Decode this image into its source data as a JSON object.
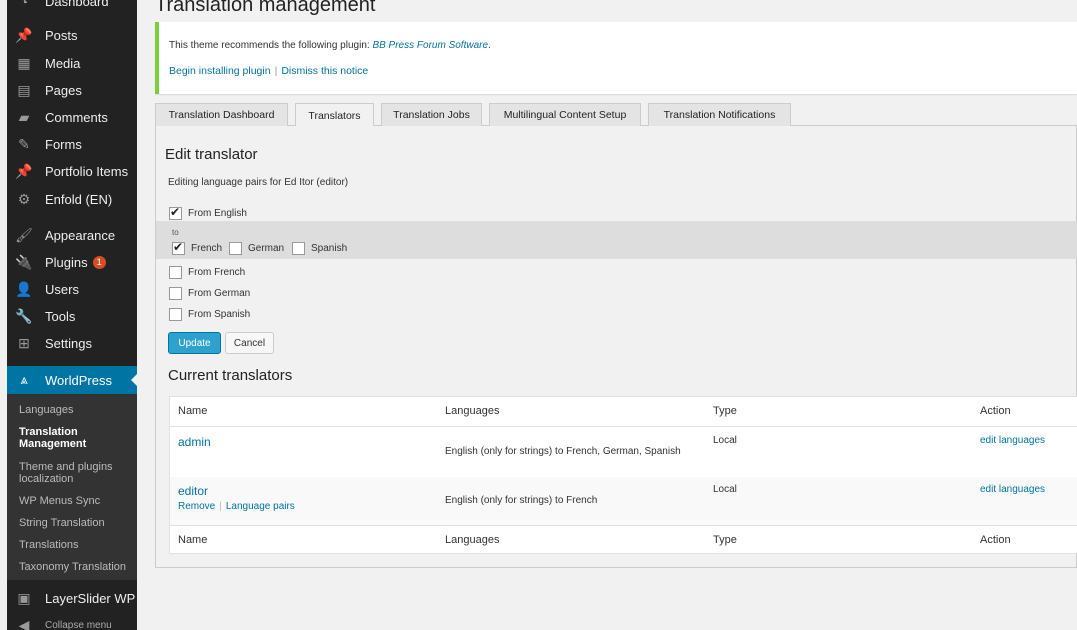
{
  "sidebar": {
    "items": [
      {
        "label": "Dashboard",
        "icon": "dashboard-icon"
      },
      {
        "label": "Posts",
        "icon": "pin-icon"
      },
      {
        "label": "Media",
        "icon": "media-icon"
      },
      {
        "label": "Pages",
        "icon": "pages-icon"
      },
      {
        "label": "Comments",
        "icon": "comment-icon"
      },
      {
        "label": "Forms",
        "icon": "forms-icon"
      },
      {
        "label": "Portfolio Items",
        "icon": "pin-icon"
      },
      {
        "label": "Enfold (EN)",
        "icon": "gear-icon"
      },
      {
        "label": "Appearance",
        "icon": "brush-icon"
      },
      {
        "label": "Plugins",
        "icon": "plugin-icon",
        "badge": "1"
      },
      {
        "label": "Users",
        "icon": "user-icon"
      },
      {
        "label": "Tools",
        "icon": "wrench-icon"
      },
      {
        "label": "Settings",
        "icon": "settings-icon"
      }
    ],
    "current": {
      "label": "WorldPress",
      "icon": "wpml-icon"
    },
    "submenu": [
      "Languages",
      "Translation Management",
      "Theme and plugins localization",
      "WP Menus Sync",
      "String Translation",
      "Translations",
      "Taxonomy Translation"
    ],
    "layerslider": "LayerSlider WP",
    "collapse": "Collapse menu"
  },
  "page": {
    "title": "Translation management"
  },
  "notice": {
    "text": "This theme recommends the following plugin: ",
    "plugin": "BB Press Forum Software",
    "period": ".",
    "install": "Begin installing plugin",
    "sep": "|",
    "dismiss": "Dismiss this notice"
  },
  "tabs": [
    "Translation Dashboard",
    "Translators",
    "Translation Jobs",
    "Multilingual Content Setup",
    "Translation Notifications"
  ],
  "edit": {
    "title": "Edit translator",
    "subtitle": "Editing language pairs for ",
    "subtitle_user": "Ed Itor (editor)",
    "from_english": "From English",
    "to": "to",
    "to_langs": [
      {
        "label": "French",
        "checked": true
      },
      {
        "label": "German",
        "checked": false
      },
      {
        "label": "Spanish",
        "checked": false
      }
    ],
    "from_french": "From French",
    "from_german": "From German",
    "from_spanish": "From Spanish",
    "update": "Update",
    "cancel": "Cancel"
  },
  "current": {
    "title": "Current translators",
    "columns": [
      "Name",
      "Languages",
      "Type",
      "Action"
    ],
    "rows": [
      {
        "name": "admin",
        "languages": "English (only for strings) to French, German, Spanish",
        "type": "Local",
        "action": "edit languages"
      },
      {
        "name": "editor",
        "languages": "English (only for strings) to French",
        "type": "Local",
        "action": "edit languages",
        "row_actions": [
          "Remove",
          "Language pairs"
        ]
      }
    ]
  }
}
